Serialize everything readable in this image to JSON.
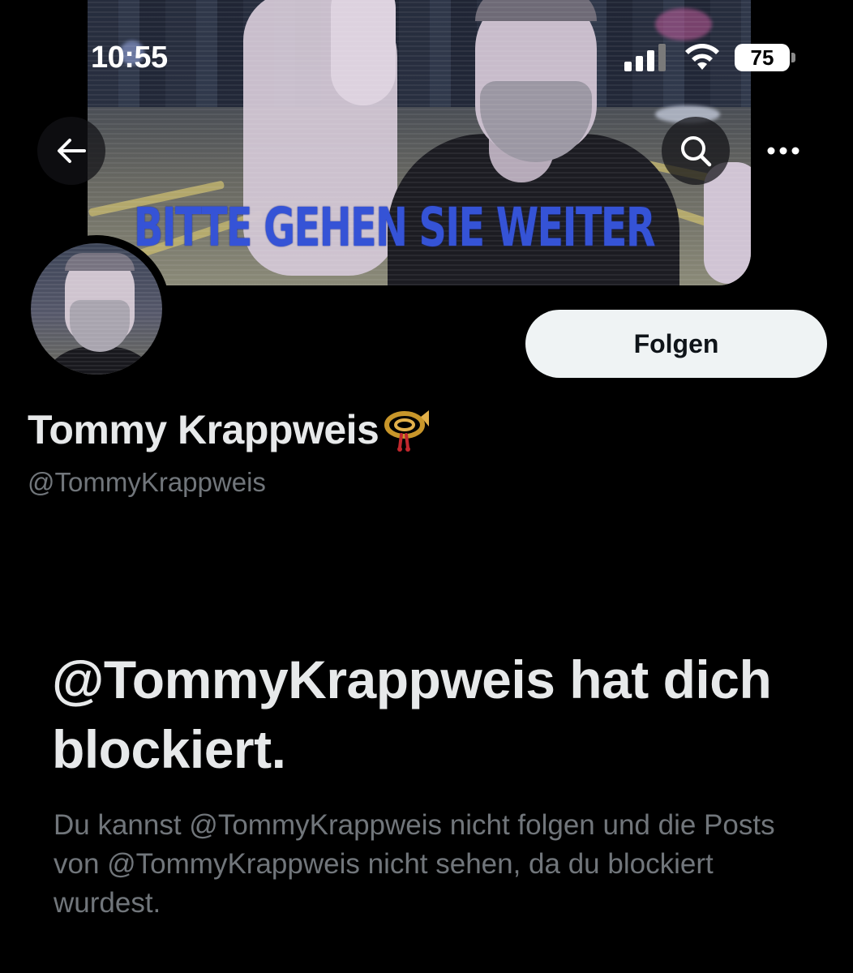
{
  "status_bar": {
    "time": "10:55",
    "battery": "75"
  },
  "banner": {
    "overlay_text": "BITTE GEHEN SIE WEITER"
  },
  "nav": {
    "back_icon": "arrow-left-icon",
    "search_icon": "search-icon",
    "more_icon": "more-horizontal-icon"
  },
  "profile": {
    "display_name": "Tommy Krappweis",
    "name_emoji": "postal-horn-icon",
    "handle": "@TommyKrappweis",
    "follow_label": "Folgen"
  },
  "blocked": {
    "title": "@TommyKrappweis hat dich blockiert.",
    "description": "Du kannst @TommyKrappweis nicht folgen und die Posts von @TommyKrappweis nicht sehen, da du blockiert wurdest."
  },
  "colors": {
    "background": "#000000",
    "primary_text": "#e7e9ea",
    "secondary_text": "#71767b",
    "button_bg": "#eff3f4",
    "banner_text": "#3553d6"
  }
}
